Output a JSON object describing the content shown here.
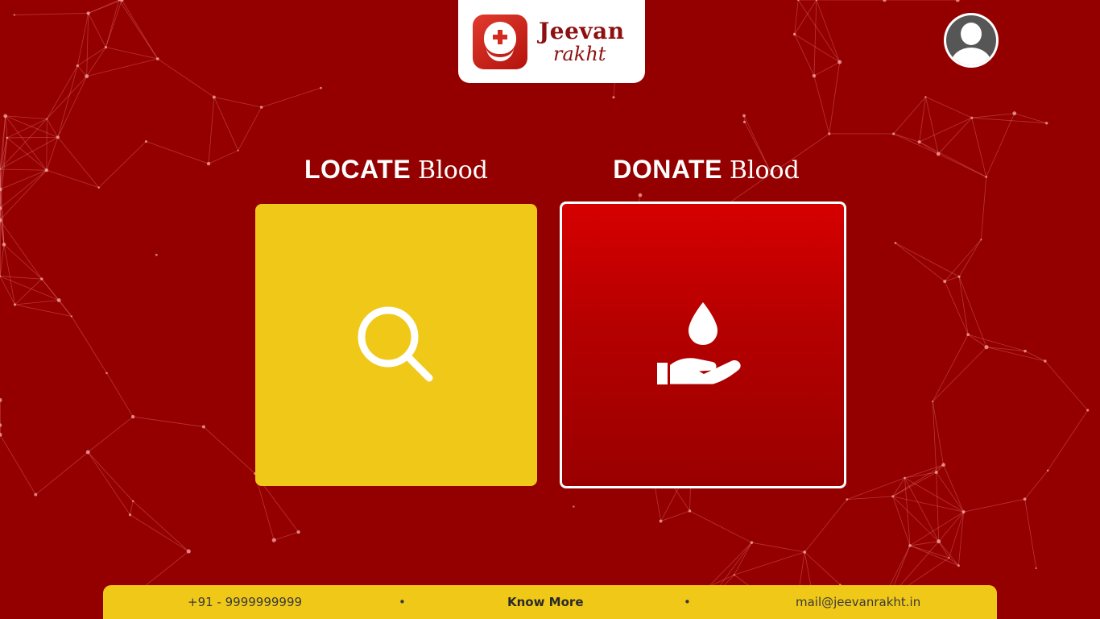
{
  "header": {
    "logo_line1": "Jeevan",
    "logo_line2": "rakht",
    "logo_icon": "blood-drop-cross-icon",
    "profile_icon": "user-avatar-icon"
  },
  "actions": {
    "locate": {
      "title_strong": "LOCATE",
      "title_soft": "Blood",
      "icon": "search-icon"
    },
    "donate": {
      "title_strong": "DONATE",
      "title_soft": "Blood",
      "icon": "hand-blood-drop-icon"
    }
  },
  "footer": {
    "phone": "+91 - 9999999999",
    "separator": "•",
    "know_more": "Know More",
    "email": "mail@jeevanrakht.in"
  },
  "colors": {
    "background": "#940000",
    "accent_yellow": "#f0c818",
    "donate_red": "#d60000",
    "white": "#ffffff"
  }
}
